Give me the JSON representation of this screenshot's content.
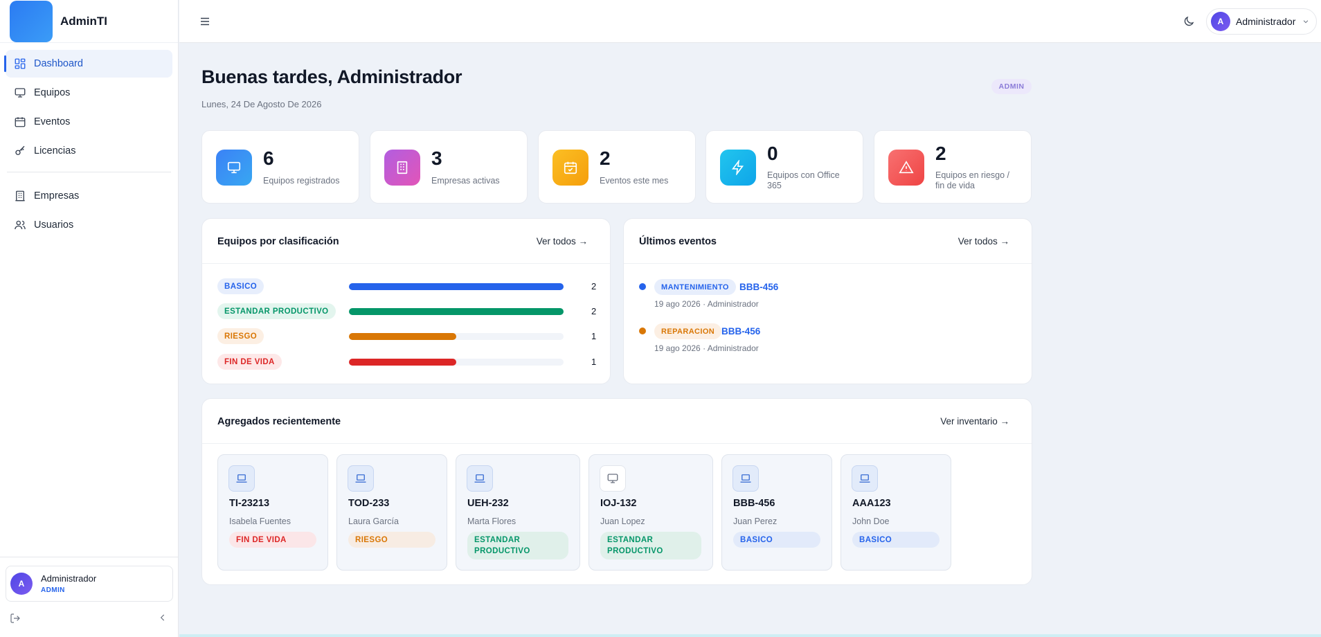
{
  "app": {
    "name": "AdminTI"
  },
  "sidebar": {
    "items": [
      {
        "label": "Dashboard",
        "icon": "dashboard-icon",
        "active": true
      },
      {
        "label": "Equipos",
        "icon": "monitor-icon"
      },
      {
        "label": "Eventos",
        "icon": "calendar-icon"
      },
      {
        "label": "Licencias",
        "icon": "key-icon"
      },
      {
        "label": "Empresas",
        "icon": "building-icon"
      },
      {
        "label": "Usuarios",
        "icon": "users-icon"
      }
    ],
    "user": {
      "initial": "A",
      "name": "Administrador",
      "role": "ADMIN"
    }
  },
  "topbar": {
    "user_initial": "A",
    "user_name": "Administrador"
  },
  "header": {
    "greeting": "Buenas tardes, Administrador",
    "date": "Lunes, 24 De Agosto De 2026",
    "role_badge": "ADMIN"
  },
  "stats": [
    {
      "value": "6",
      "label": "Equipos registrados",
      "color": "#3b82f6",
      "icon": "monitor-icon"
    },
    {
      "value": "3",
      "label": "Empresas activas",
      "color": "#c056d6",
      "icon": "building-icon"
    },
    {
      "value": "2",
      "label": "Eventos este mes",
      "color": "#f59e0b",
      "icon": "calendar-icon"
    },
    {
      "value": "0",
      "label": "Equipos con Office 365",
      "color": "#1eb4e6",
      "icon": "bolt-icon"
    },
    {
      "value": "2",
      "label": "Equipos en riesgo / fin de vida",
      "color": "#ef4444",
      "icon": "warning-icon"
    }
  ],
  "classification": {
    "title": "Equipos por clasificación",
    "link": "Ver todos →",
    "rows": [
      {
        "label": "BASICO",
        "count": "2",
        "fraction": 1.0,
        "color": "#2563eb",
        "bg": "#e7eefc"
      },
      {
        "label": "ESTANDAR PRODUCTIVO",
        "count": "2",
        "fraction": 1.0,
        "color": "#059669",
        "bg": "#e3f5ee"
      },
      {
        "label": "RIESGO",
        "count": "1",
        "fraction": 0.5,
        "color": "#d97706",
        "bg": "#fcefe3"
      },
      {
        "label": "FIN DE VIDA",
        "count": "1",
        "fraction": 0.5,
        "color": "#dc2626",
        "bg": "#fde8e8"
      }
    ]
  },
  "events": {
    "title": "Últimos eventos",
    "link": "Ver todos →",
    "items": [
      {
        "type": "MANTENIMIENTO",
        "code": "BBB-456",
        "meta": "19 ago 2026 · Administrador",
        "color": "#2563eb",
        "bg": "#e7eefc"
      },
      {
        "type": "REPARACION",
        "code": "BBB-456",
        "meta": "19 ago 2026 · Administrador",
        "color": "#d97706",
        "bg": "#fcefe3"
      }
    ]
  },
  "recent": {
    "title": "Agregados recientemente",
    "link": "Ver inventario →",
    "items": [
      {
        "code": "TI-23213",
        "owner": "Isabela Fuentes",
        "status": "FIN DE VIDA",
        "icon": "laptop-icon"
      },
      {
        "code": "TOD-233",
        "owner": "Laura García",
        "status": "RIESGO",
        "icon": "laptop-icon"
      },
      {
        "code": "UEH-232",
        "owner": "Marta Flores",
        "status": "ESTANDAR PRODUCTIVO",
        "icon": "laptop-icon"
      },
      {
        "code": "IOJ-132",
        "owner": "Juan Lopez",
        "status": "ESTANDAR PRODUCTIVO",
        "icon": "desktop-icon"
      },
      {
        "code": "BBB-456",
        "owner": "Juan Perez",
        "status": "BASICO",
        "icon": "laptop-icon"
      },
      {
        "code": "AAA123",
        "owner": "John Doe",
        "status": "BASICO",
        "icon": "laptop-icon"
      }
    ]
  }
}
